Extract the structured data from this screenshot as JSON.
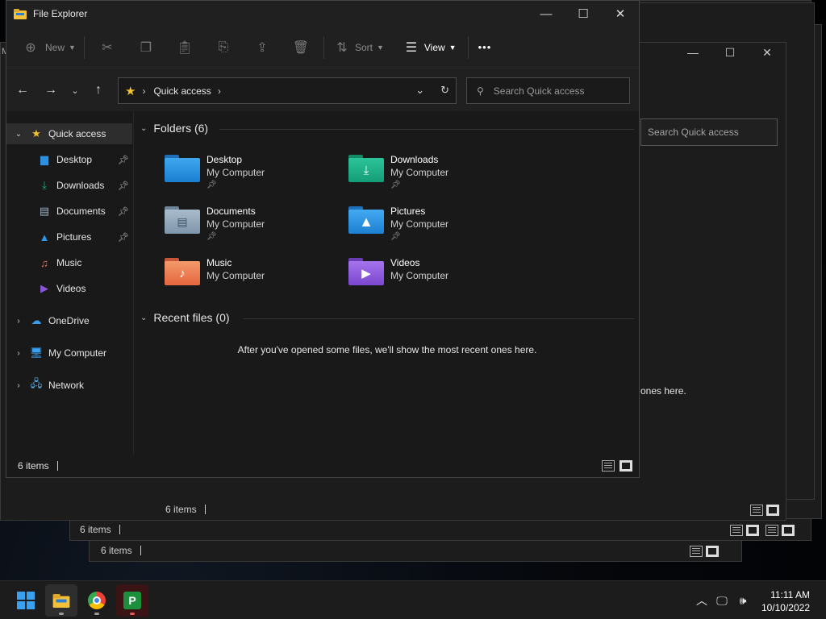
{
  "window": {
    "title": "File Explorer",
    "controls": {
      "minimize": "—",
      "maximize": "☐",
      "close": "✕"
    }
  },
  "toolbar": {
    "new_label": "New",
    "sort_label": "Sort",
    "view_label": "View",
    "more_label": "•••"
  },
  "address_bar": {
    "location": "Quick access"
  },
  "search": {
    "placeholder": "Search Quick access"
  },
  "sidebar": {
    "items": [
      {
        "label": "Quick access",
        "icon": "star-icon"
      },
      {
        "label": "Desktop",
        "icon": "desktop-folder-icon",
        "pinned": true
      },
      {
        "label": "Downloads",
        "icon": "download-icon",
        "pinned": true
      },
      {
        "label": "Documents",
        "icon": "document-icon",
        "pinned": true
      },
      {
        "label": "Pictures",
        "icon": "pictures-icon",
        "pinned": true
      },
      {
        "label": "Music",
        "icon": "music-icon"
      },
      {
        "label": "Videos",
        "icon": "videos-icon"
      },
      {
        "label": "OneDrive",
        "icon": "onedrive-icon"
      },
      {
        "label": "My Computer",
        "icon": "computer-icon"
      },
      {
        "label": "Network",
        "icon": "network-icon"
      }
    ]
  },
  "main": {
    "folders_header": "Folders (6)",
    "folders": [
      {
        "name": "Desktop",
        "location": "My Computer",
        "pinned": true,
        "color": "#2d8fe0"
      },
      {
        "name": "Downloads",
        "location": "My Computer",
        "pinned": true,
        "color": "#1fae86"
      },
      {
        "name": "Documents",
        "location": "My Computer",
        "pinned": true,
        "color": "#8da3b8"
      },
      {
        "name": "Pictures",
        "location": "My Computer",
        "pinned": true,
        "color": "#2f97e6"
      },
      {
        "name": "Music",
        "location": "My Computer",
        "pinned": false,
        "color": "#e8744d"
      },
      {
        "name": "Videos",
        "location": "My Computer",
        "pinned": false,
        "color": "#8a55d6"
      }
    ],
    "recent_header": "Recent files (0)",
    "recent_empty": "After you've opened some files, we'll show the most recent ones here."
  },
  "status": {
    "item_count": "6 items"
  },
  "ghost_windows": {
    "search_placeholder": "Search Quick access",
    "recent_fragment": "ones here.",
    "item_count": "6 items",
    "fragment_m": "M",
    "fragment_6": "6",
    "fragment_6i": "6 i"
  },
  "taskbar": {
    "time": "11:11 AM",
    "date": "10/10/2022"
  },
  "colors": {
    "accent": "#3aa0f0",
    "star": "#f4c430"
  }
}
